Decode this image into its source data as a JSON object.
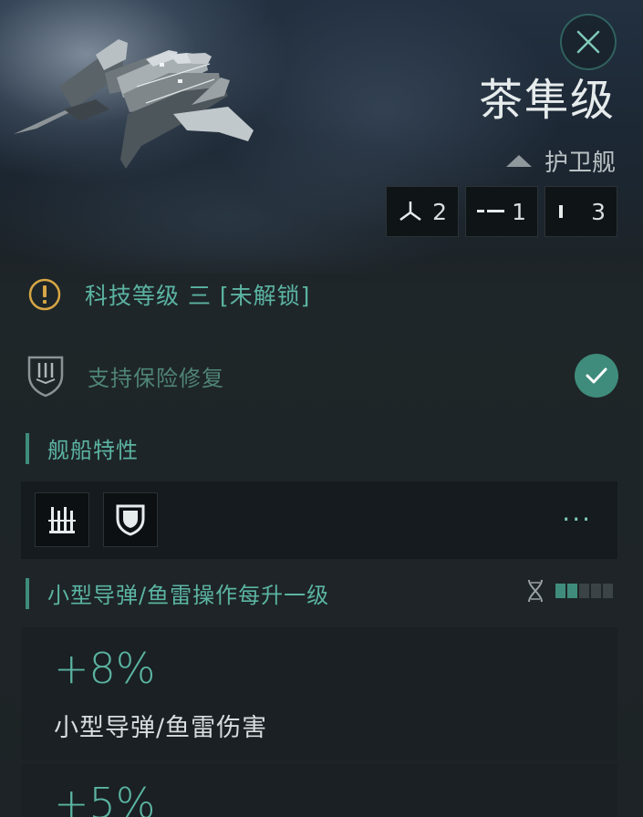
{
  "ship": {
    "name": "茶隼级",
    "class_label": "护卫舰",
    "class_icon": "frigate-triangle-icon"
  },
  "slots": [
    {
      "icon": "high-slot-icon",
      "count": "2"
    },
    {
      "icon": "mid-slot-icon",
      "count": "1"
    },
    {
      "icon": "low-slot-icon",
      "count": "3"
    }
  ],
  "tech": {
    "icon": "warning-icon",
    "text": "科技等级 三 [未解锁]"
  },
  "insurance": {
    "icon": "insurance-shield-icon",
    "text": "支持保险修复",
    "checked": true
  },
  "traits_section": {
    "label": "舰船特性",
    "icons": [
      "missile-launchers-icon",
      "shield-icon"
    ],
    "more": "···"
  },
  "skill_section": {
    "label": "小型导弹/鱼雷操作每升一级",
    "level_icon": "dna-helix-icon",
    "level": 2,
    "level_max": 5
  },
  "bonuses": [
    {
      "value": "+8%",
      "desc": "小型导弹/鱼雷伤害"
    },
    {
      "value": "+5%",
      "desc": ""
    }
  ],
  "colors": {
    "accent": "#5bb4a2",
    "accent_dark": "#3f8c7c",
    "warning": "#d6a645",
    "background": "#1d2327"
  }
}
